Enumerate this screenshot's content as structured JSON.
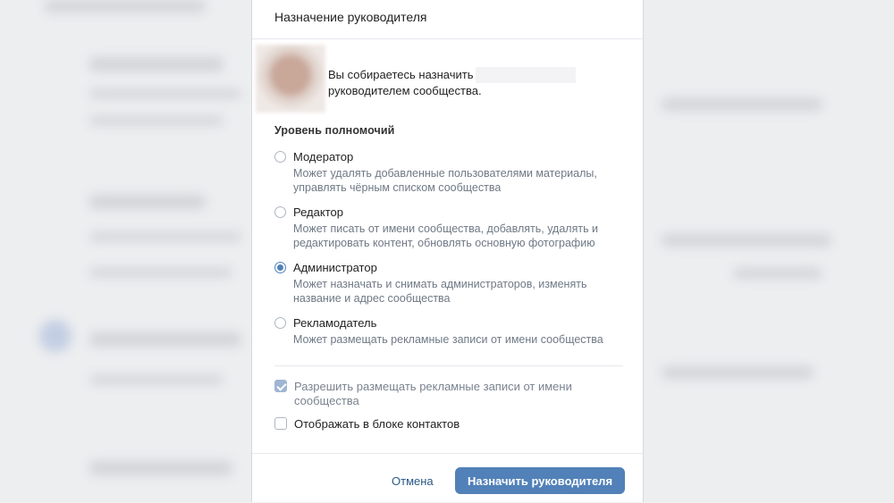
{
  "modal": {
    "title": "Назначение руководителя",
    "intro_line1": "Вы собираетесь назначить",
    "intro_line2": "руководителем сообщества.",
    "section_title": "Уровень полномочий",
    "options": [
      {
        "title": "Модератор",
        "desc": "Может удалять добавленные пользователями материалы, управлять чёрным списком сообщества",
        "checked": false
      },
      {
        "title": "Редактор",
        "desc": "Может писать от имени сообщества, добавлять, удалять и редактировать контент, обновлять основную фотографию",
        "checked": false
      },
      {
        "title": "Администратор",
        "desc": "Может назначать и снимать администраторов, изменять название и адрес сообщества",
        "checked": true
      },
      {
        "title": "Рекламодатель",
        "desc": "Может размещать рекламные записи от имени сообщества",
        "checked": false
      }
    ],
    "checkboxes": [
      {
        "label": "Разрешить размещать рекламные записи от имени сообщества",
        "checked": true,
        "disabled": true
      },
      {
        "label": "Отображать в блоке контактов",
        "checked": false,
        "disabled": false
      }
    ],
    "cancel_label": "Отмена",
    "confirm_label": "Назначить руководителя"
  },
  "colors": {
    "accent": "#5181b8",
    "link": "#2a5885",
    "muted_text": "#6f7985"
  }
}
